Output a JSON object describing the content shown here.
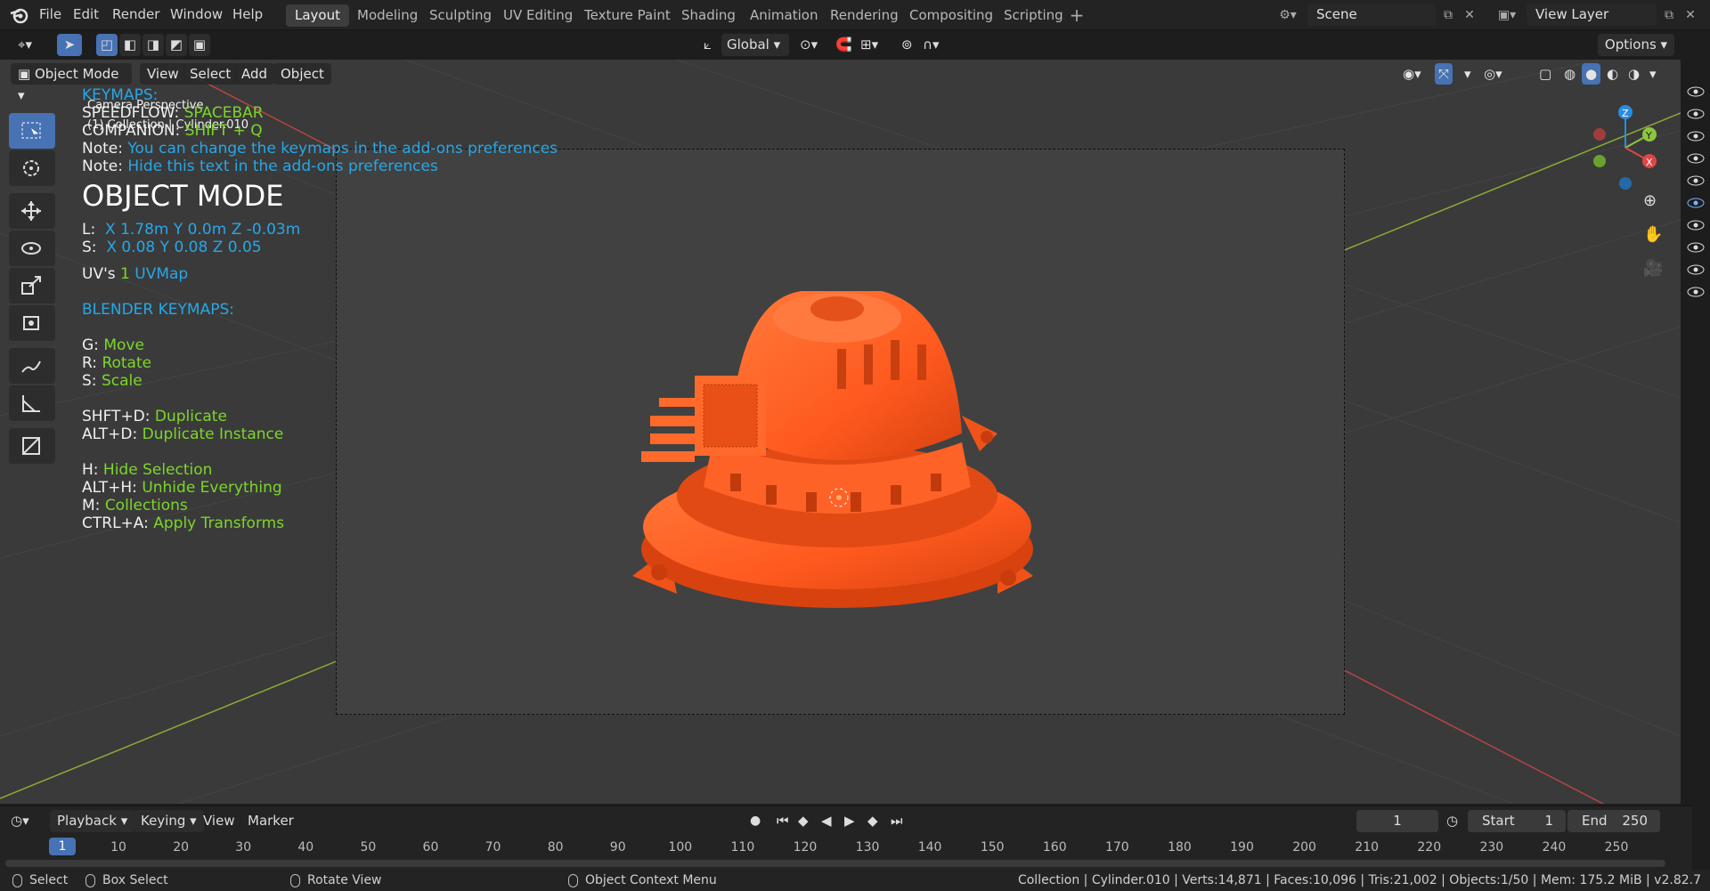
{
  "menu": [
    "File",
    "Edit",
    "Render",
    "Window",
    "Help"
  ],
  "workspaces": [
    "Layout",
    "Modeling",
    "Sculpting",
    "UV Editing",
    "Texture Paint",
    "Shading",
    "Animation",
    "Rendering",
    "Compositing",
    "Scripting"
  ],
  "active_workspace": "Layout",
  "scene_name": "Scene",
  "view_layer_name": "View Layer",
  "transform_orientation": "Global",
  "options_label": "Options",
  "viewport_header": {
    "mode": "Object Mode",
    "menus": [
      "View",
      "Select",
      "Add",
      "Object"
    ]
  },
  "viewport_info": {
    "line1": "Camera Perspective",
    "line2": "(1) Collection | Cylinder.010"
  },
  "overlay": {
    "keymaps_label": "KEYMAPS:",
    "speedflow_key": "SPEEDFLOW:",
    "speedflow_val": "SPACEBAR",
    "companion_key": "COMPANION:",
    "companion_val": "SHIFT + Q",
    "note1_key": "Note:",
    "note1_val": "You can change the keymaps in the add-ons preferences",
    "note2_key": "Note:",
    "note2_val": "Hide this text in the add-ons preferences",
    "mode_title": "OBJECT MODE",
    "loc_key": "L:",
    "loc_x": "X 1.78m",
    "loc_y": "Y 0.0m",
    "loc_z": "Z -0.03m",
    "scale_key": "S:",
    "scale_x": "X 0.08",
    "scale_y": "Y 0.08",
    "scale_z": "Z 0.05",
    "uv_key": "UV's",
    "uv_count": "1",
    "uv_name": "UVMap",
    "blender_keymaps": "BLENDER KEYMAPS:",
    "shortcuts": [
      {
        "key": "G:",
        "action": "Move"
      },
      {
        "key": "R:",
        "action": "Rotate"
      },
      {
        "key": "S:",
        "action": "Scale"
      },
      {
        "key": "SHFT+D:",
        "action": "Duplicate"
      },
      {
        "key": "ALT+D:",
        "action": "Duplicate Instance"
      },
      {
        "key": "H:",
        "action": "Hide Selection"
      },
      {
        "key": "ALT+H:",
        "action": "Unhide Everything"
      },
      {
        "key": "M:",
        "action": "Collections"
      },
      {
        "key": "CTRL+A:",
        "action": "Apply Transforms"
      }
    ]
  },
  "gizmo": {
    "x": "X",
    "y": "Y",
    "z": "Z"
  },
  "timeline": {
    "menus": [
      "Playback",
      "Keying",
      "View",
      "Marker"
    ],
    "current_frame": "1",
    "start_label": "Start",
    "start": "1",
    "end_label": "End",
    "end": "250",
    "ruler": [
      "1",
      "10",
      "20",
      "30",
      "40",
      "50",
      "60",
      "70",
      "80",
      "90",
      "100",
      "110",
      "120",
      "130",
      "140",
      "150",
      "160",
      "170",
      "180",
      "190",
      "200",
      "210",
      "220",
      "230",
      "240",
      "250"
    ]
  },
  "statusbar": {
    "select": "Select",
    "box_select": "Box Select",
    "rotate_view": "Rotate View",
    "context_menu": "Object Context Menu",
    "stats": "Collection | Cylinder.010 | Verts:14,871 | Faces:10,096 | Tris:21,002 | Objects:1/50 | Mem: 175.2 MiB | v2.82.7"
  },
  "colors": {
    "accent": "#4772b3",
    "object": "#ff5a1f",
    "overlay_blue": "#27a7e8",
    "overlay_green": "#7cd62a"
  }
}
